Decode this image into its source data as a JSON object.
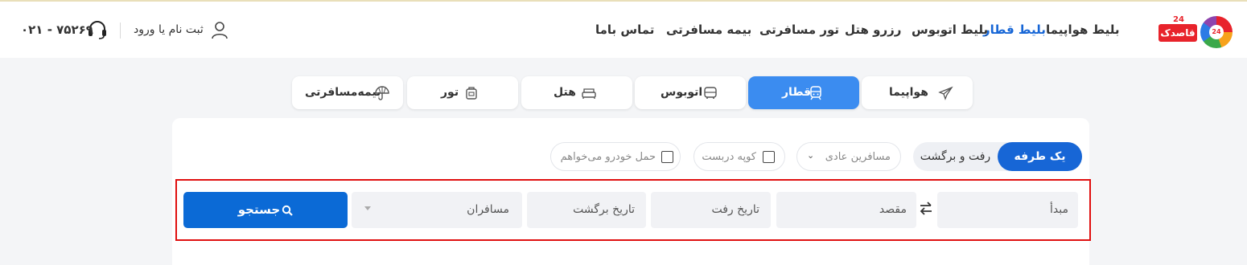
{
  "brand": {
    "logo_text": "قاصدک",
    "logo_badge": "24",
    "logo_mark": "24"
  },
  "nav": {
    "items": [
      {
        "label": "بلیط هواپیما",
        "active": false
      },
      {
        "label": "بلیط قطار",
        "active": true
      },
      {
        "label": "بلیط اتوبوس",
        "active": false
      },
      {
        "label": "رزرو هتل",
        "active": false
      },
      {
        "label": "تور مسافرتی",
        "active": false
      },
      {
        "label": "بیمه مسافرتی",
        "active": false
      },
      {
        "label": "تماس باما",
        "active": false
      }
    ]
  },
  "account": {
    "login_label": "ثبت نام یا ورود",
    "user_icon": "user-icon"
  },
  "support": {
    "phone": "۰۲۱ - ۷۵۲۶۹",
    "icon": "headset-icon"
  },
  "tabs": [
    {
      "label": "هواپیما",
      "icon": "airplane-icon",
      "active": false
    },
    {
      "label": "قطار",
      "icon": "train-icon",
      "active": true
    },
    {
      "label": "اتوبوس",
      "icon": "bus-icon",
      "active": false
    },
    {
      "label": "هتل",
      "icon": "bed-icon",
      "active": false
    },
    {
      "label": "تور",
      "icon": "luggage-icon",
      "active": false
    },
    {
      "label": "بیمه‌مسافرتی",
      "icon": "umbrella-icon",
      "active": false
    }
  ],
  "trip_type": {
    "one_way": "یک طرفه",
    "round_trip": "رفت و برگشت",
    "selected": "one_way"
  },
  "passenger_type": {
    "value": "مسافرین عادی"
  },
  "options": {
    "coupe": "کوپه دربست",
    "car": "حمل خودرو می‌خواهم"
  },
  "form": {
    "origin": "مبدأ",
    "destination": "مقصد",
    "depart_date": "تاریخ رفت",
    "return_date": "تاریخ برگشت",
    "passengers": "مسافران",
    "search_label": "جستجو"
  },
  "colors": {
    "primary": "#1766d6",
    "tab_active": "#3b8cf0",
    "highlight": "#e01010",
    "brand_red": "#e8232b"
  }
}
